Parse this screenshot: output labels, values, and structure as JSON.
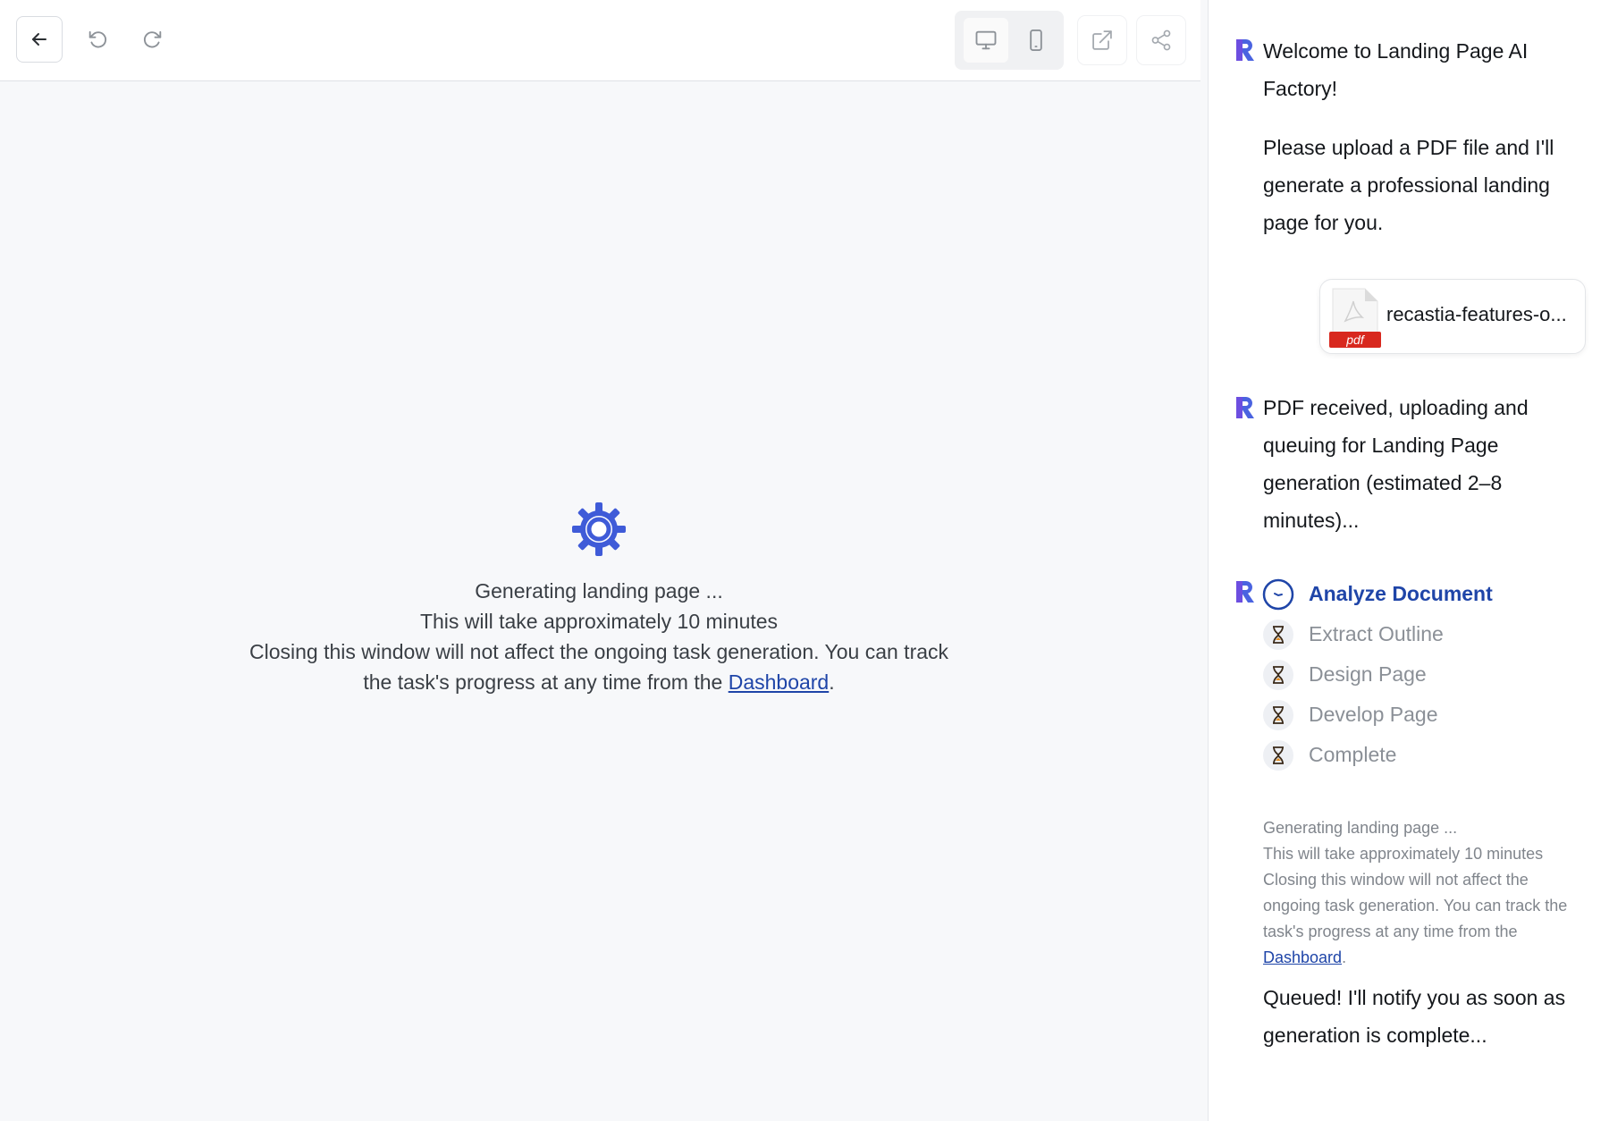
{
  "toolbar": {
    "back_icon": "arrow-left-icon",
    "undo_icon": "undo-icon",
    "redo_icon": "redo-icon",
    "desktop_icon": "monitor-icon",
    "mobile_icon": "smartphone-icon",
    "open_icon": "external-link-icon",
    "share_icon": "share-icon"
  },
  "preview": {
    "icon": "gear-icon",
    "line1": "Generating landing page ...",
    "line2": "This will take approximately 10 minutes",
    "line3_prefix": "Closing this window will not affect the ongoing task generation. You can track the task's progress at any time from the ",
    "link": "Dashboard",
    "line3_suffix": "."
  },
  "chat": {
    "welcome_title": "Welcome to Landing Page AI Factory!",
    "welcome_body": "Please upload a PDF file and I'll generate a professional landing page for you.",
    "file": {
      "name": "recastia-features-o...",
      "type_badge": "pdf"
    },
    "received": "PDF received, uploading and queuing for Landing Page generation (estimated 2–8 minutes)...",
    "steps": [
      {
        "label": "Analyze Document",
        "status": "active",
        "icon": "clock-icon"
      },
      {
        "label": "Extract Outline",
        "status": "pending",
        "icon": "hourglass-icon"
      },
      {
        "label": "Design Page",
        "status": "pending",
        "icon": "hourglass-icon"
      },
      {
        "label": "Develop Page",
        "status": "pending",
        "icon": "hourglass-icon"
      },
      {
        "label": "Complete",
        "status": "pending",
        "icon": "hourglass-icon"
      }
    ],
    "note": {
      "line1": "Generating landing page ...",
      "line2": "This will take approximately 10 minutes",
      "line3_prefix": "Closing this window will not affect the ongoing task generation. You can track the task's progress at any time from the ",
      "link": "Dashboard",
      "line3_suffix": "."
    },
    "queued": "Queued! I'll notify you as soon as generation is complete..."
  },
  "colors": {
    "accent": "#1f45a8",
    "gear": "#3f5bd8",
    "pdf_red": "#d8281e",
    "hourglass": "#e0891c"
  }
}
